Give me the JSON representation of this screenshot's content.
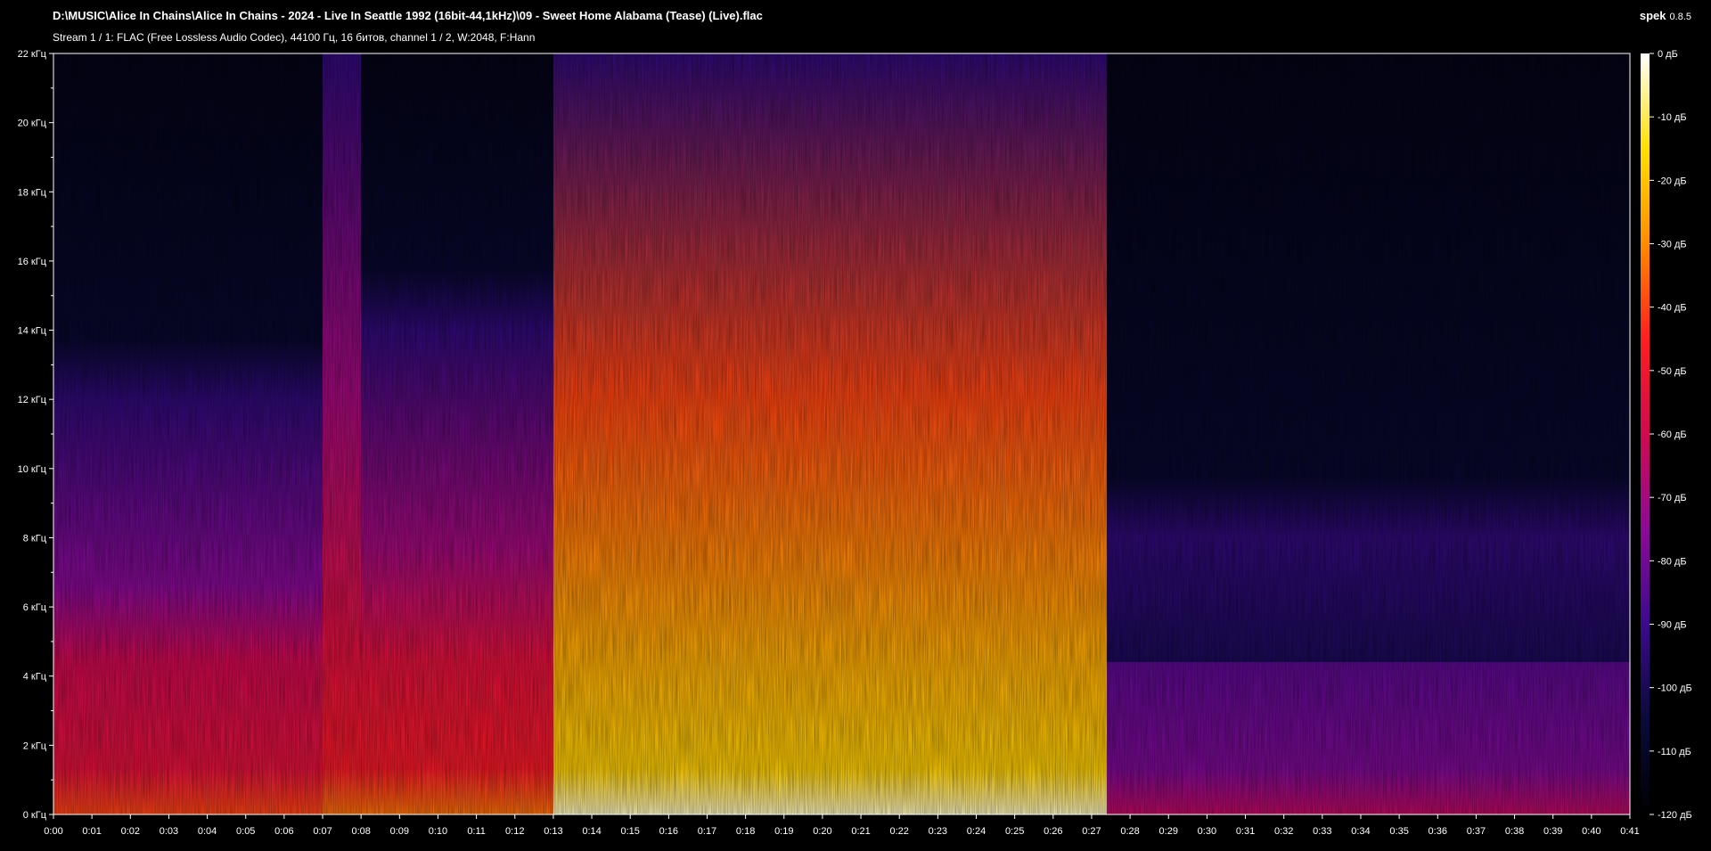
{
  "header": {
    "title": "D:\\MUSIC\\Alice In Chains\\Alice In Chains - 2024 - Live In Seattle 1992 (16bit-44,1kHz)\\09 - Sweet Home Alabama (Tease) (Live).flac",
    "subtitle": "Stream 1 / 1: FLAC (Free Lossless Audio Codec), 44100 Гц, 16 битов, channel 1 / 2, W:2048, F:Hann",
    "app_name": "spek",
    "app_version": "0.8.5"
  },
  "chart_data": {
    "type": "heatmap",
    "title": "",
    "x_axis": {
      "label": "",
      "range_seconds": [
        0,
        41
      ],
      "ticks": [
        "0:00",
        "0:01",
        "0:02",
        "0:03",
        "0:04",
        "0:05",
        "0:06",
        "0:07",
        "0:08",
        "0:09",
        "0:10",
        "0:11",
        "0:12",
        "0:13",
        "0:14",
        "0:15",
        "0:16",
        "0:17",
        "0:18",
        "0:19",
        "0:20",
        "0:21",
        "0:22",
        "0:23",
        "0:24",
        "0:25",
        "0:26",
        "0:27",
        "0:28",
        "0:29",
        "0:30",
        "0:31",
        "0:32",
        "0:33",
        "0:34",
        "0:35",
        "0:36",
        "0:37",
        "0:38",
        "0:39",
        "0:40",
        "0:41"
      ]
    },
    "y_axis": {
      "label": "",
      "unit": "кГц",
      "range_khz": [
        0,
        22
      ],
      "ticks": [
        "0 кГц",
        "2 кГц",
        "4 кГц",
        "6 кГц",
        "8 кГц",
        "10 кГц",
        "12 кГц",
        "14 кГц",
        "16 кГц",
        "18 кГц",
        "20 кГц",
        "22 кГц"
      ]
    },
    "colorbar": {
      "range_db": [
        -120,
        0
      ],
      "ticks": [
        "0 дБ",
        "-10 дБ",
        "-20 дБ",
        "-30 дБ",
        "-40 дБ",
        "-50 дБ",
        "-60 дБ",
        "-70 дБ",
        "-80 дБ",
        "-90 дБ",
        "-100 дБ",
        "-110 дБ",
        "-120 дБ"
      ],
      "stops": [
        "#000000",
        "#0a0a3a",
        "#3c0a8c",
        "#8c0a96",
        "#d00a50",
        "#ff1e1e",
        "#ff8c00",
        "#ffe000",
        "#ffffff"
      ]
    },
    "description_segments": [
      {
        "start_s": 0.0,
        "end_s": 7.0,
        "band_top_khz": 12,
        "intensity": 0.55
      },
      {
        "start_s": 7.0,
        "end_s": 8.0,
        "band_top_khz": 22,
        "intensity": 0.6
      },
      {
        "start_s": 8.0,
        "end_s": 13.0,
        "band_top_khz": 14,
        "intensity": 0.6
      },
      {
        "start_s": 13.0,
        "end_s": 27.4,
        "band_top_khz": 22,
        "intensity": 0.85
      },
      {
        "start_s": 27.4,
        "end_s": 41.0,
        "band_top_khz": 8,
        "intensity": 0.35
      }
    ]
  }
}
